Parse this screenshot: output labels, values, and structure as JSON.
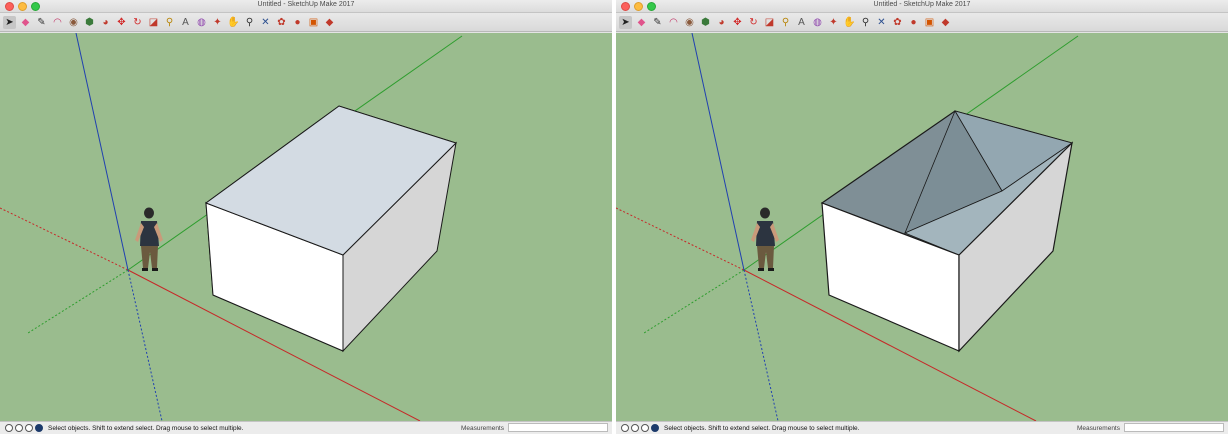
{
  "window_title": "Untitled - SketchUp Make 2017",
  "toolbar": {
    "tools": [
      {
        "name": "select-tool",
        "glyph": "➤",
        "color": "#222222"
      },
      {
        "name": "eraser-tool",
        "glyph": "◆",
        "color": "#e0548c"
      },
      {
        "name": "line-tool",
        "glyph": "✎",
        "color": "#333333"
      },
      {
        "name": "arc-tool",
        "glyph": "◠",
        "color": "#c23a6a"
      },
      {
        "name": "shapes-tool",
        "glyph": "◉",
        "color": "#8a5a3c"
      },
      {
        "name": "push-pull-tool",
        "glyph": "⬢",
        "color": "#3b7a3b"
      },
      {
        "name": "follow-me-tool",
        "glyph": "◕",
        "color": "#c0392b"
      },
      {
        "name": "move-tool",
        "glyph": "✥",
        "color": "#d12b2b"
      },
      {
        "name": "rotate-tool",
        "glyph": "↻",
        "color": "#d12b2b"
      },
      {
        "name": "scale-tool",
        "glyph": "◪",
        "color": "#c0392b"
      },
      {
        "name": "tape-measure-tool",
        "glyph": "⚲",
        "color": "#b8860b"
      },
      {
        "name": "text-tool",
        "glyph": "A",
        "color": "#555555"
      },
      {
        "name": "paint-bucket-tool",
        "glyph": "◍",
        "color": "#8e44ad"
      },
      {
        "name": "orbit-tool",
        "glyph": "✦",
        "color": "#c0392b"
      },
      {
        "name": "pan-tool",
        "glyph": "✋",
        "color": "#d4a017"
      },
      {
        "name": "zoom-tool",
        "glyph": "⚲",
        "color": "#333333"
      },
      {
        "name": "zoom-extents-tool",
        "glyph": "✕",
        "color": "#2c4f8f"
      },
      {
        "name": "warehouse-tool",
        "glyph": "✿",
        "color": "#c0392b"
      },
      {
        "name": "extension-warehouse-tool",
        "glyph": "●",
        "color": "#c0392b"
      },
      {
        "name": "layout-tool",
        "glyph": "▣",
        "color": "#d35400"
      },
      {
        "name": "ruby-tool",
        "glyph": "◆",
        "color": "#c0392b"
      }
    ]
  },
  "status": {
    "message": "Select objects. Shift to extend select. Drag mouse to select multiple.",
    "measurements_label": "Measurements",
    "measurements_value": ""
  },
  "colors": {
    "ground": "#9abc8e",
    "axis_red": "#c62828",
    "axis_green": "#2e9d2e",
    "axis_blue": "#2040b0",
    "box_top_selected": "#d3dbe3",
    "box_front": "#ffffff",
    "box_side": "#d6d6d6",
    "box_inner": "#7f8f96"
  }
}
